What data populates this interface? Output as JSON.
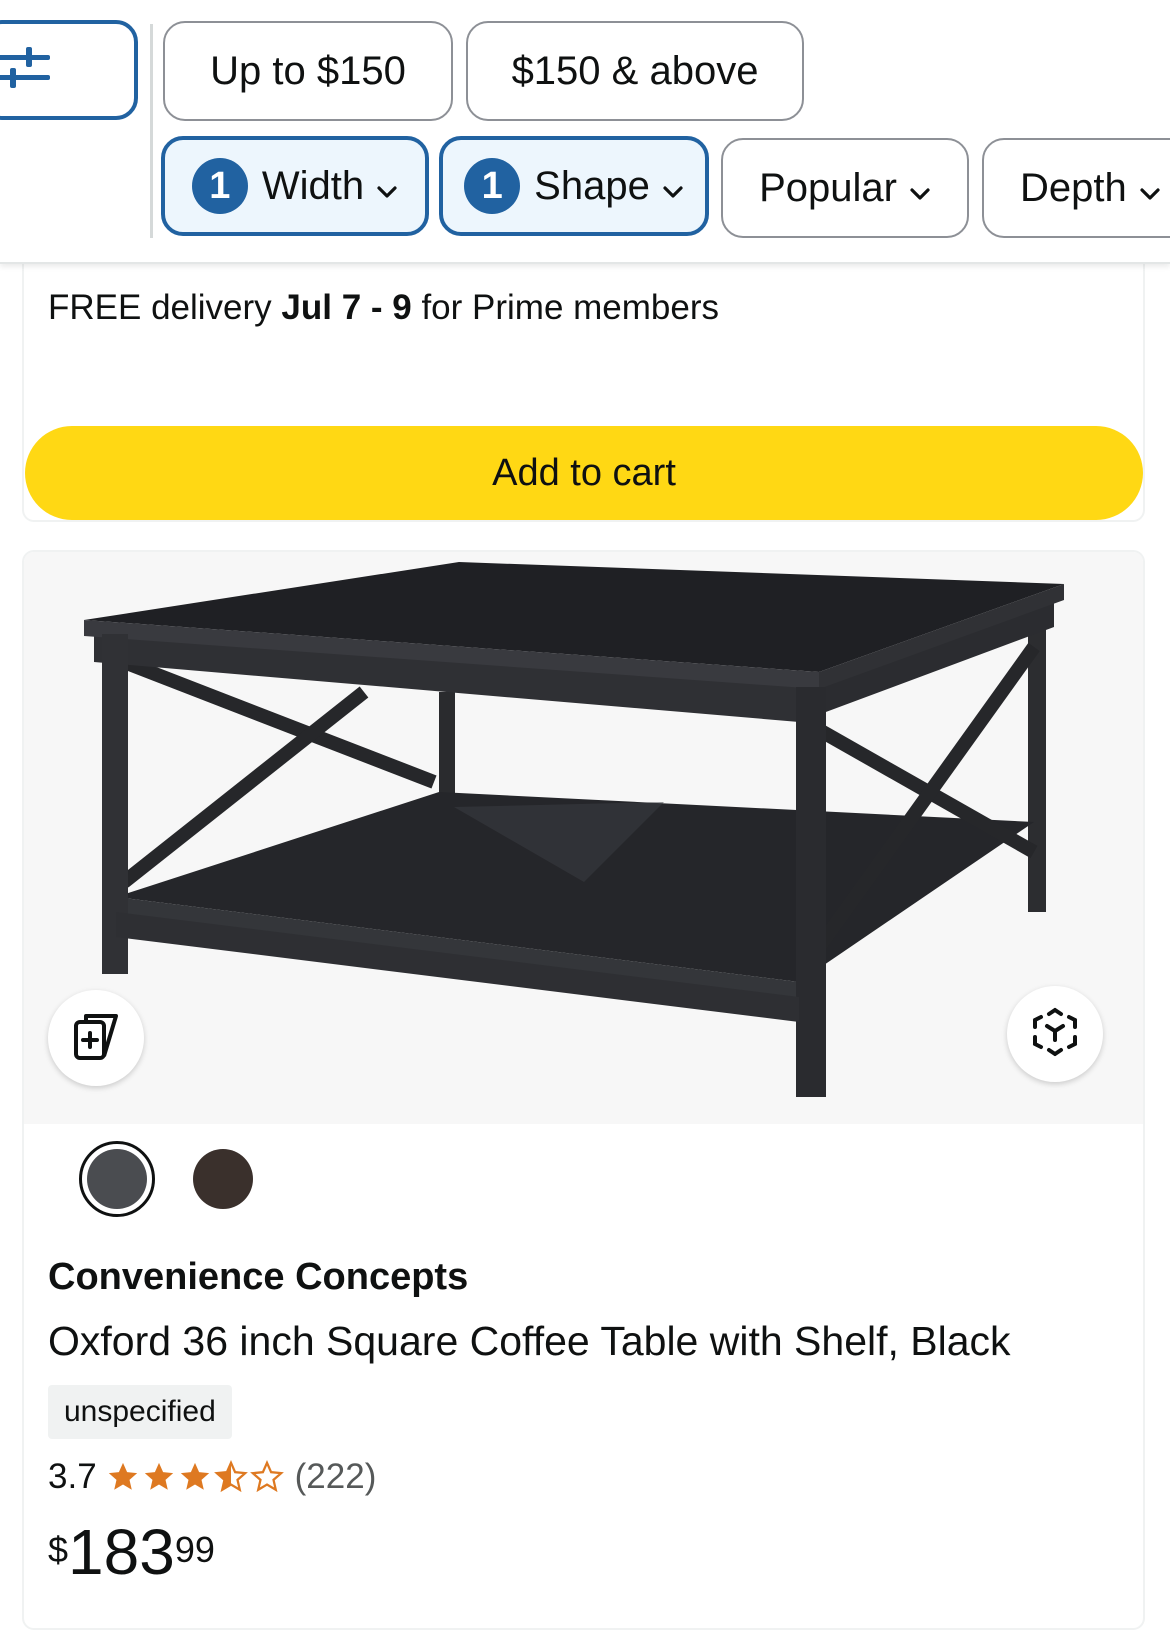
{
  "filters": {
    "row1": [
      {
        "label": "Up to $150"
      },
      {
        "label": "$150 & above"
      }
    ],
    "row2": [
      {
        "badge": "1",
        "label": "Width",
        "active": true
      },
      {
        "badge": "1",
        "label": "Shape",
        "active": true
      },
      {
        "label": "Popular",
        "active": false
      },
      {
        "label": "Depth",
        "active": false
      }
    ]
  },
  "previous_item": {
    "delivery_prefix": "FREE delivery ",
    "delivery_dates": "Jul 7 - 9",
    "delivery_suffix": " for Prime members",
    "add_to_cart": "Add to cart"
  },
  "product": {
    "brand": "Convenience Concepts",
    "title": "Oxford 36 inch Square Coffee Table with Shelf, Black",
    "tag": "unspecified",
    "rating_value": "3.7",
    "stars": 3.7,
    "review_count": "(222)",
    "price_symbol": "$",
    "price_whole": "183",
    "price_fraction": "99",
    "swatches": [
      {
        "color": "#4a4c50",
        "selected": true
      },
      {
        "color": "#3a302c",
        "selected": false
      }
    ]
  },
  "colors": {
    "accent_blue": "#2162a1",
    "add_to_cart_yellow": "#ffd814",
    "star_orange": "#de7921"
  },
  "icons": [
    "filter-sliders-icon",
    "chevron-down-icon",
    "compare-add-icon",
    "view-in-3d-icon",
    "star-icon"
  ]
}
